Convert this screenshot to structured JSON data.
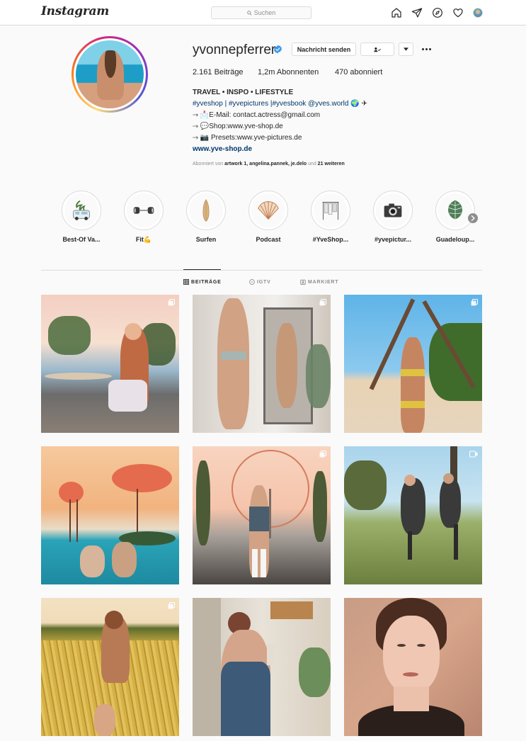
{
  "nav": {
    "logo": "Instagram",
    "search_placeholder": "Suchen",
    "icons": [
      "home-icon",
      "direct-icon",
      "explore-icon",
      "activity-heart-icon",
      "profile-avatar"
    ]
  },
  "profile": {
    "username": "yvonnepferrer",
    "verified": true,
    "message_button": "Nachricht senden",
    "follow_button_icon": "person-check-icon",
    "dropdown_icon": "chevron-down-icon",
    "more_icon": "more-dots-icon",
    "stats": {
      "posts": "2.161 Beiträge",
      "followers": "1,2m Abonnenten",
      "following": "470 abonniert"
    },
    "bio": {
      "name": "TRAVEL • INSPO • LIFESTYLE",
      "line1_tags": "#yveshop | #yvepictures |#yvesbook @yves.world",
      "line1_emoji": " 🌍 ✈",
      "line2": "⤑ 📩E-Mail: contact.actress@gmail.com",
      "line3": "⤑ 💬Shop:www.yve-shop.de",
      "line4": "⤑ 📷 Presets:www.yve-pictures.de",
      "url": "www.yve-shop.de"
    },
    "followed_by": {
      "prefix": "Abonniert von ",
      "names": "artwork 1, angelina.pannek, je.delo",
      "suffix": " und ",
      "more": "21 weiteren"
    }
  },
  "highlights": [
    {
      "label": "Best-Of Va...",
      "icon": "van-icon"
    },
    {
      "label": "Fit💪",
      "icon": "dumbbell-icon"
    },
    {
      "label": "Surfen",
      "icon": "surfboard-icon"
    },
    {
      "label": "Podcast",
      "icon": "shell-icon"
    },
    {
      "label": "#YveShop...",
      "icon": "clothes-rack-icon"
    },
    {
      "label": "#yvepictur...",
      "icon": "camera-icon"
    },
    {
      "label": "Guadeloup...",
      "icon": "palm-leaf-icon"
    }
  ],
  "tabs": [
    {
      "label": "BEITRÄGE",
      "icon": "grid-icon",
      "active": true
    },
    {
      "label": "IGTV",
      "icon": "igtv-icon",
      "active": false
    },
    {
      "label": "MARKIERT",
      "icon": "tagged-icon",
      "active": false
    }
  ],
  "posts": [
    {
      "scene": "bonsai terrace with laptop",
      "badge": "carousel-icon",
      "colors": [
        "#f4d3c0",
        "#c06a44",
        "#4a6b3b",
        "#9ab8cc"
      ]
    },
    {
      "scene": "mirror selfie in bedroom",
      "badge": "carousel-icon",
      "colors": [
        "#e9e6e2",
        "#c9c1b6",
        "#d1a284",
        "#7a8c7d"
      ]
    },
    {
      "scene": "beach under palm trees",
      "badge": "carousel-icon",
      "colors": [
        "#5fb4e8",
        "#e8d3b4",
        "#e0c241",
        "#3f6c2b"
      ]
    },
    {
      "scene": "pink flamingo clouds over sea",
      "badge": "",
      "colors": [
        "#f1b37f",
        "#e56b4e",
        "#2aa3b8",
        "#d9e7ea"
      ]
    },
    {
      "scene": "ferris wheel street",
      "badge": "carousel-icon",
      "colors": [
        "#f5c4ab",
        "#a7a09a",
        "#4a4542",
        "#d6714a"
      ]
    },
    {
      "scene": "kick in the park",
      "badge": "igtv-icon",
      "colors": [
        "#a9d4ec",
        "#6c7f3e",
        "#3a3a3a",
        "#9bb06a"
      ]
    },
    {
      "scene": "rapeseed field sunset",
      "badge": "carousel-icon",
      "colors": [
        "#f2e1c2",
        "#d7b146",
        "#5d6d2b",
        "#b77a55"
      ]
    },
    {
      "scene": "kitchen with plants",
      "badge": "",
      "colors": [
        "#e8e2d8",
        "#3d5a78",
        "#b9844e",
        "#6c8e5a"
      ]
    },
    {
      "scene": "close-up portrait",
      "badge": "",
      "colors": [
        "#d7a58a",
        "#6b3f2c",
        "#2b1f1b",
        "#f0c7b3"
      ]
    }
  ]
}
